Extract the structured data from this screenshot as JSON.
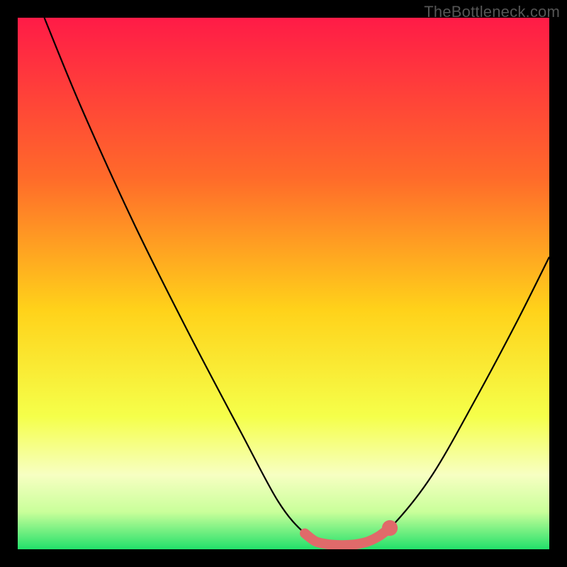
{
  "watermark": "TheBottleneck.com",
  "chart_data": {
    "type": "line",
    "title": "",
    "xlabel": "",
    "ylabel": "",
    "xlim": [
      0,
      100
    ],
    "ylim": [
      0,
      100
    ],
    "gradient_stops": [
      {
        "offset": 0,
        "color": "#ff1b47"
      },
      {
        "offset": 30,
        "color": "#ff6a2a"
      },
      {
        "offset": 55,
        "color": "#ffd21a"
      },
      {
        "offset": 75,
        "color": "#f5ff4a"
      },
      {
        "offset": 86,
        "color": "#f7ffc2"
      },
      {
        "offset": 93,
        "color": "#c9ff9a"
      },
      {
        "offset": 100,
        "color": "#22e06a"
      }
    ],
    "series": [
      {
        "name": "bottleneck-curve",
        "color": "#000000",
        "points": [
          {
            "x": 5,
            "y": 100
          },
          {
            "x": 12,
            "y": 83
          },
          {
            "x": 22,
            "y": 61
          },
          {
            "x": 32,
            "y": 41
          },
          {
            "x": 42,
            "y": 22
          },
          {
            "x": 49,
            "y": 9
          },
          {
            "x": 54,
            "y": 3
          },
          {
            "x": 58,
            "y": 1
          },
          {
            "x": 63,
            "y": 1
          },
          {
            "x": 67,
            "y": 2
          },
          {
            "x": 71,
            "y": 5
          },
          {
            "x": 78,
            "y": 14
          },
          {
            "x": 86,
            "y": 28
          },
          {
            "x": 94,
            "y": 43
          },
          {
            "x": 100,
            "y": 55
          }
        ]
      }
    ],
    "marker_band": {
      "name": "optimal-range",
      "color": "#e06a6a",
      "points": [
        {
          "x": 54,
          "y": 3
        },
        {
          "x": 56,
          "y": 1.5
        },
        {
          "x": 58,
          "y": 1
        },
        {
          "x": 60,
          "y": 0.8
        },
        {
          "x": 62,
          "y": 0.8
        },
        {
          "x": 64,
          "y": 1
        },
        {
          "x": 66,
          "y": 1.5
        },
        {
          "x": 68,
          "y": 2.5
        },
        {
          "x": 70,
          "y": 4
        }
      ]
    },
    "marker_end_dot": {
      "x": 70,
      "y": 4,
      "r": 1.2,
      "color": "#e06a6a"
    }
  }
}
